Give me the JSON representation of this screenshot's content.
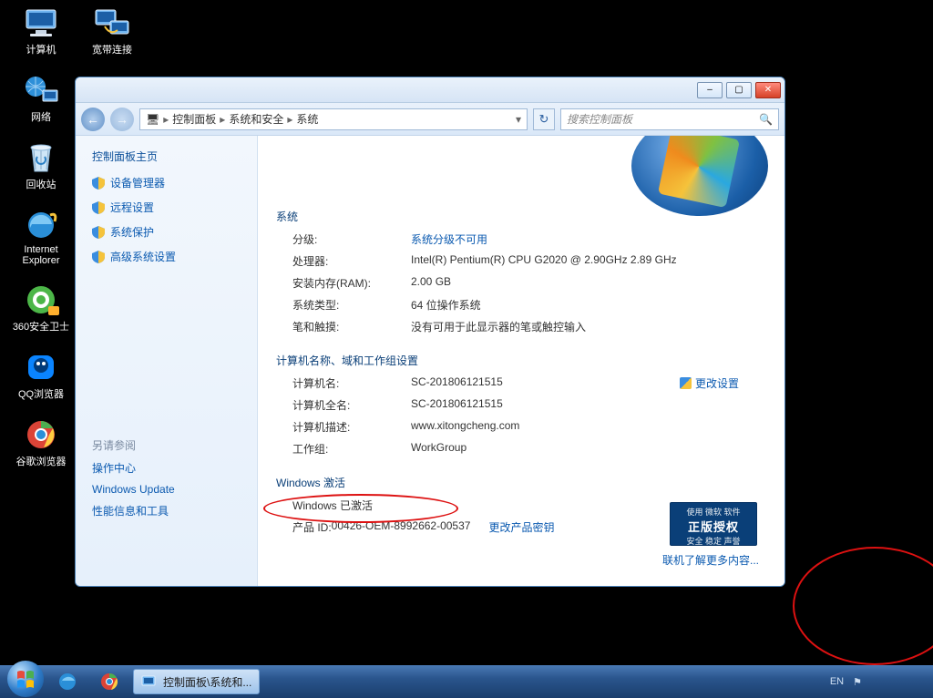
{
  "desktop_icons_col1": [
    {
      "id": "computer",
      "label": "计算机"
    },
    {
      "id": "network",
      "label": "网络"
    },
    {
      "id": "recycle",
      "label": "回收站"
    },
    {
      "id": "ie",
      "label": "Internet Explorer"
    },
    {
      "id": "360",
      "label": "360安全卫士"
    },
    {
      "id": "qqb",
      "label": "QQ浏览器"
    },
    {
      "id": "chrome",
      "label": "谷歌浏览器"
    }
  ],
  "desktop_icons_col2": [
    {
      "id": "dialup",
      "label": "宽带连接"
    }
  ],
  "window": {
    "min": "–",
    "max": "▢",
    "close": "✕",
    "breadcrumb": {
      "root_icon": "🖥",
      "p1": "控制面板",
      "p2": "系统和安全",
      "p3": "系统"
    },
    "search_placeholder": "搜索控制面板",
    "sidebar": {
      "home": "控制面板主页",
      "links": [
        "设备管理器",
        "远程设置",
        "系统保护",
        "高级系统设置"
      ],
      "also_title": "另请参阅",
      "also": [
        "操作中心",
        "Windows Update",
        "性能信息和工具"
      ]
    },
    "content": {
      "sys_h": "系统",
      "rating_k": "分级:",
      "rating_v": "系统分级不可用",
      "cpu_k": "处理器:",
      "cpu_v": "Intel(R) Pentium(R) CPU G2020 @ 2.90GHz   2.89 GHz",
      "ram_k": "安装内存(RAM):",
      "ram_v": "2.00 GB",
      "type_k": "系统类型:",
      "type_v": "64 位操作系统",
      "pen_k": "笔和触摸:",
      "pen_v": "没有可用于此显示器的笔或触控输入",
      "grp_h": "计算机名称、域和工作组设置",
      "cname_k": "计算机名:",
      "cname_v": "SC-201806121515",
      "change": "更改设置",
      "cfull_k": "计算机全名:",
      "cfull_v": "SC-201806121515",
      "cdesc_k": "计算机描述:",
      "cdesc_v": "www.xitongcheng.com",
      "wg_k": "工作组:",
      "wg_v": "WorkGroup",
      "act_h": "Windows 激活",
      "act_status": "Windows 已激活",
      "pid_k": "产品 ID: ",
      "pid_v": "00426-OEM-8992662-00537",
      "pid_link": "更改产品密钥",
      "badge_t1": "使用 微软 软件",
      "badge_t2": "正版授权",
      "badge_t3": "安全 稳定 声誉",
      "more": "联机了解更多内容..."
    }
  },
  "taskbar": {
    "active_title": "控制面板\\系统和...",
    "lang": "EN"
  }
}
